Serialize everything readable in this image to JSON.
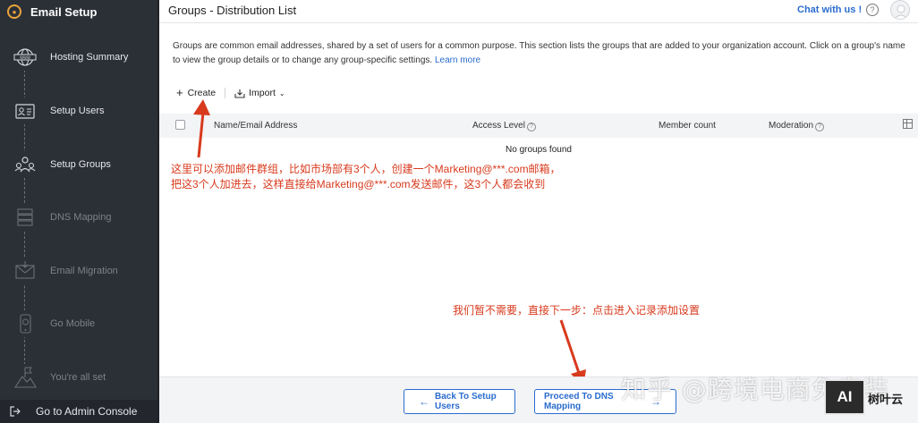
{
  "sidebar": {
    "title": "Email Setup",
    "steps": [
      {
        "label": "Hosting Summary",
        "icon": "globe-icon"
      },
      {
        "label": "Setup Users",
        "icon": "user-card-icon"
      },
      {
        "label": "Setup Groups",
        "icon": "group-icon"
      },
      {
        "label": "DNS Mapping",
        "icon": "server-icon"
      },
      {
        "label": "Email Migration",
        "icon": "envelope-icon"
      },
      {
        "label": "Go Mobile",
        "icon": "mobile-icon"
      },
      {
        "label": "You're all set",
        "icon": "flag-icon"
      }
    ],
    "console_label": "Go to Admin Console"
  },
  "header": {
    "title": "Groups - Distribution List",
    "chat_label": "Chat with us !",
    "help_glyph": "?"
  },
  "content": {
    "description": "Groups are common email addresses, shared by a set of users for a common purpose. This section lists the groups that are added to your organization account. Click on a group's name to view the group details or to change any group-specific settings.",
    "learn_more": "Learn more",
    "toolbar": {
      "create_label": "Create",
      "import_label": "Import"
    },
    "table": {
      "columns": [
        "Name/Email Address",
        "Access Level",
        "Member count",
        "Moderation"
      ],
      "empty_text": "No groups found"
    }
  },
  "annotations": {
    "note1_line1": "这里可以添加邮件群组，比如市场部有3个人，创建一个Marketing@***.com邮箱，",
    "note1_line2": "把这3个人加进去，这样直接给Marketing@***.com发送邮件，这3个人都会收到",
    "note2": "我们暂不需要，直接下一步：点击进入记录添加设置",
    "color": "#d83a1d"
  },
  "footer": {
    "back_label": "Back To Setup Users",
    "next_label": "Proceed To DNS Mapping"
  },
  "watermark": {
    "text": "知乎 @跨境电商免安装",
    "logo_text": "AI",
    "logo_label": "树叶云"
  },
  "colors": {
    "sidebar_bg": "#2b2f36",
    "accent": "#2a6ccf",
    "brand_orange": "#e8a33c"
  }
}
